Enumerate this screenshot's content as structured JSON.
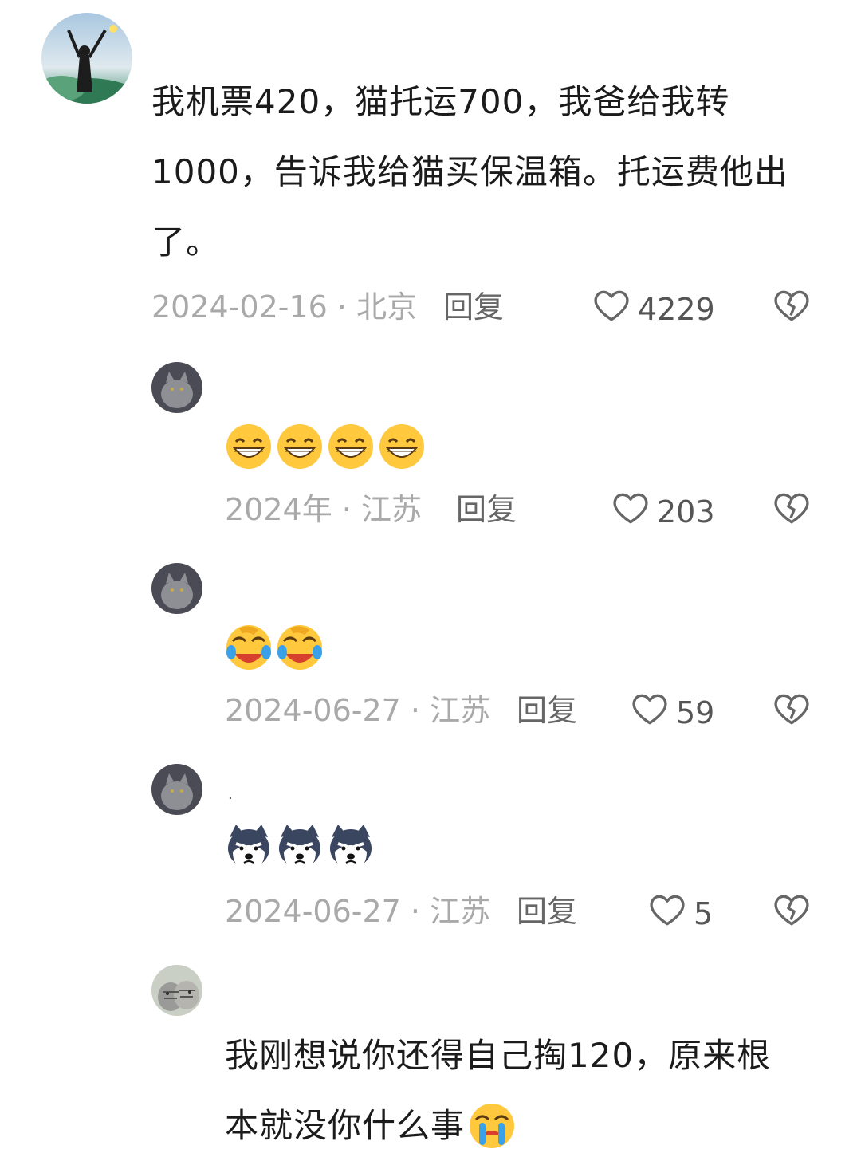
{
  "comments": [
    {
      "text": "我机票420，猫托运700，我爸给我转1000，告诉我给猫买保温箱。托运费他出了。",
      "date": "2024-02-16",
      "location": "北京",
      "reply_label": "回复",
      "likes": "4229",
      "avatar_icon": "person-arms-raised-avatar"
    },
    {
      "emojis": [
        "grin-emoji",
        "grin-emoji",
        "grin-emoji",
        "grin-emoji"
      ],
      "date": "2024年",
      "location": "江苏",
      "reply_label": "回复",
      "likes": "203",
      "avatar_icon": "gray-cat-avatar"
    },
    {
      "emojis": [
        "crying-laughing-emoji",
        "crying-laughing-emoji"
      ],
      "date": "2024-06-27",
      "location": "江苏",
      "reply_label": "回复",
      "likes": "59",
      "avatar_icon": "gray-cat-avatar"
    },
    {
      "prefix": ".",
      "emojis": [
        "husky-emoji",
        "husky-emoji",
        "husky-emoji"
      ],
      "date": "2024-06-27",
      "location": "江苏",
      "reply_label": "回复",
      "likes": "5",
      "avatar_icon": "gray-cat-avatar"
    },
    {
      "text_line1": "我刚想说你还得自己掏120，原来根",
      "text_line2": "本就没你什么事",
      "avatar_icon": "tabby-cat-avatar"
    }
  ],
  "separator": " · ",
  "colors": {
    "meta": "#a9a9a9",
    "icon": "#666666",
    "emoji_yellow": "#ffc83d"
  }
}
